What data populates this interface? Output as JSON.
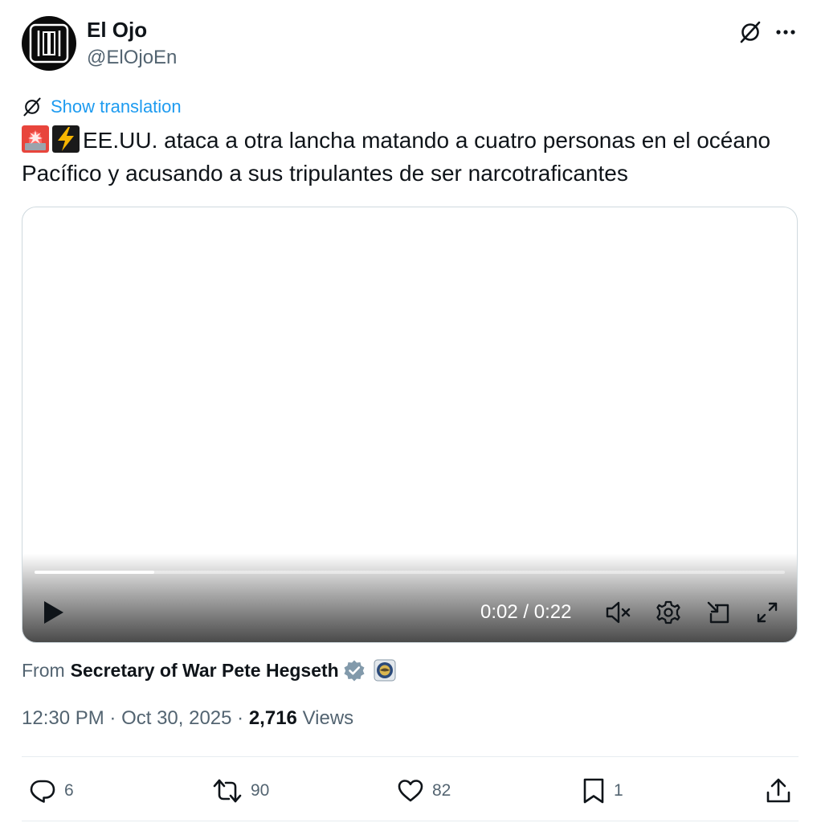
{
  "author": {
    "name": "El Ojo",
    "handle": "@ElOjoEn",
    "avatar_icon": "eye-logo-icon"
  },
  "header_actions": {
    "icons": [
      "translate-icon",
      "more-icon"
    ]
  },
  "translation": {
    "link_label": "Show translation"
  },
  "tweet": {
    "emojis": [
      "police-light-icon",
      "lightning-icon"
    ],
    "text": "EE.UU. ataca a otra lancha matando a cuatro personas en el océano Pacífico y acusando a sus tripulantes de ser narcotraficantes"
  },
  "video": {
    "time": "0:02 / 0:22",
    "progress": 0.16,
    "controls": [
      "play-icon",
      "mute-icon",
      "settings-icon",
      "pip-icon",
      "fullscreen-icon"
    ]
  },
  "source": {
    "from_label": "From",
    "name": "Secretary of War Pete Hegseth",
    "badges": [
      "verified-badge-icon",
      "affiliate-seal-icon"
    ]
  },
  "meta": {
    "time": "12:30 PM",
    "date": "Oct 30, 2025",
    "views_count": "2,716",
    "views_label": "Views"
  },
  "actions": {
    "replies": "6",
    "reposts": "90",
    "likes": "82",
    "bookmarks": "1"
  },
  "colors": {
    "accent": "#1d9bf0",
    "secondary_text": "#536471",
    "primary_text": "#0f1419",
    "verified_badge": "#829aab"
  }
}
